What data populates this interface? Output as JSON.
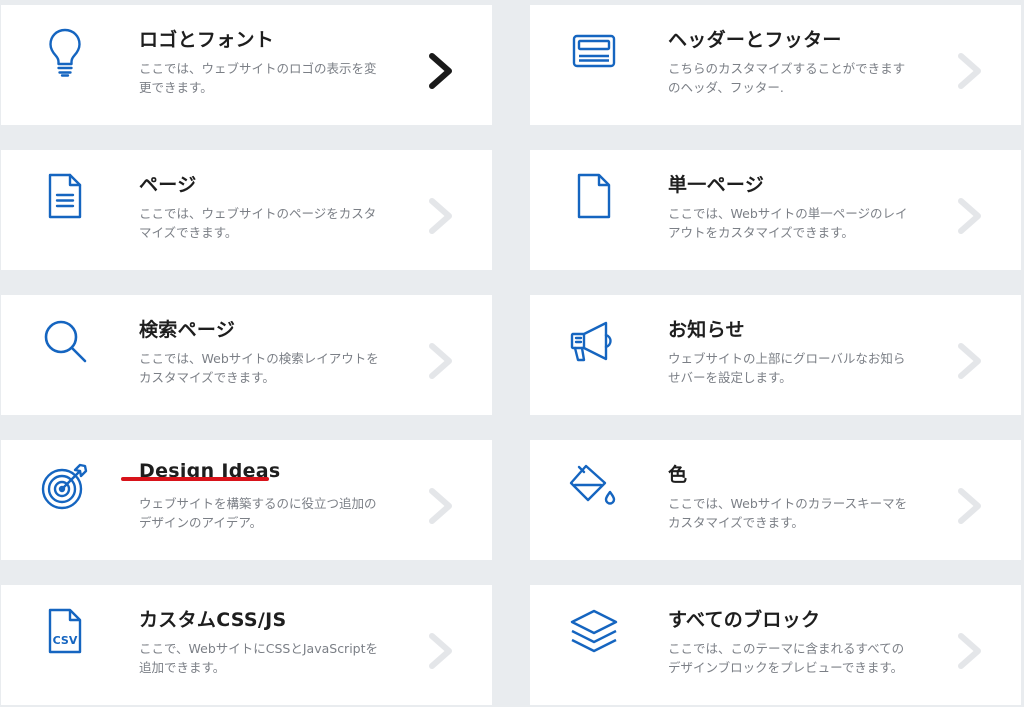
{
  "colors": {
    "icon": "#1565c0",
    "chevron_active": "#1a1a1a",
    "chevron_inactive": "#e4e6e9",
    "highlight_underline": "#d8131a"
  },
  "cards": [
    {
      "title": "ロゴとフォント",
      "desc": "ここでは、ウェブサイトのロゴの表示を変更できます。",
      "icon": "lightbulb-icon",
      "chevron": "active"
    },
    {
      "title": "ヘッダーとフッター",
      "desc": "こちらのカスタマイズすることができますのヘッダ、フッター.",
      "icon": "header-footer-icon",
      "chevron": "inactive"
    },
    {
      "title": "ページ",
      "desc": "ここでは、ウェブサイトのページをカスタマイズできます。",
      "icon": "document-icon",
      "chevron": "inactive"
    },
    {
      "title": "単一ページ",
      "desc": "ここでは、Webサイトの単一ページのレイアウトをカスタマイズできます。",
      "icon": "blank-page-icon",
      "chevron": "inactive"
    },
    {
      "title": "検索ページ",
      "desc": "ここでは、Webサイトの検索レイアウトをカスタマイズできます。",
      "icon": "search-icon",
      "chevron": "inactive"
    },
    {
      "title": "お知らせ",
      "desc": "ウェブサイトの上部にグローバルなお知らせバーを設定します。",
      "icon": "megaphone-icon",
      "chevron": "inactive"
    },
    {
      "title": "Design Ideas",
      "desc": "ウェブサイトを構築するのに役立つ追加のデザインのアイデア。",
      "icon": "target-icon",
      "chevron": "inactive"
    },
    {
      "title": "色",
      "desc": "ここでは、Webサイトのカラースキーマをカスタマイズできます。",
      "icon": "paint-bucket-icon",
      "chevron": "inactive"
    },
    {
      "title": "カスタムCSS/JS",
      "desc": "ここで、WebサイトにCSSとJavaScriptを追加できます。",
      "icon": "csv-file-icon",
      "chevron": "inactive"
    },
    {
      "title": "すべてのブロック",
      "desc": "ここでは、このテーマに含まれるすべてのデザインブロックをプレビューできます。",
      "icon": "layers-icon",
      "chevron": "inactive"
    }
  ]
}
